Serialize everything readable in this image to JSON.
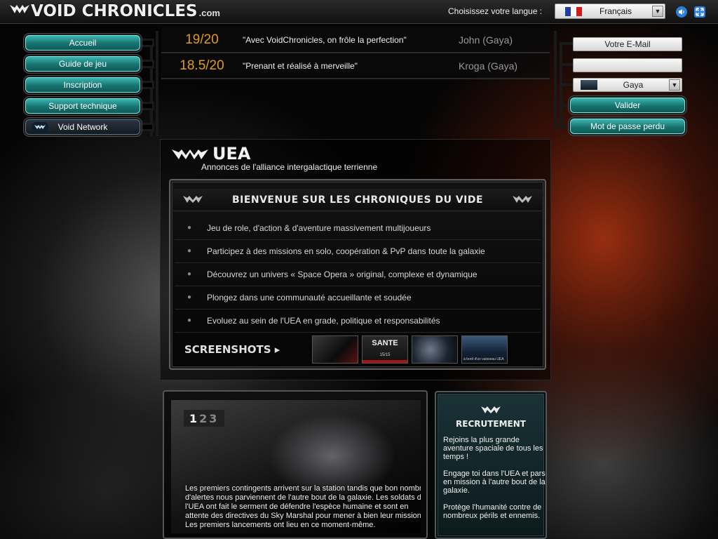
{
  "header": {
    "logo_text": "VOID CHRONICLES",
    "logo_suffix": ".com",
    "language_label": "Choisissez votre langue :",
    "language_value": "Français",
    "sound_icon": "speaker-icon",
    "fullscreen_icon": "fullscreen-icon"
  },
  "nav": {
    "items": [
      {
        "label": "Accueil"
      },
      {
        "label": "Guide de jeu"
      },
      {
        "label": "Inscription"
      },
      {
        "label": "Support technique"
      },
      {
        "label": "Void Network"
      }
    ]
  },
  "reviews": [
    {
      "score": "19/20",
      "quote": "\"Avec VoidChronicles, on frôle la perfection\"",
      "author": "John (Gaya)"
    },
    {
      "score": "18.5/20",
      "quote": "\"Prenant et réalisé à merveille\"",
      "author": "Kroga (Gaya)"
    }
  ],
  "login": {
    "email_placeholder": "Votre E-Mail",
    "password_placeholder": "",
    "server_value": "Gaya",
    "submit_label": "Valider",
    "forgot_label": "Mot de passe perdu"
  },
  "uea": {
    "title": "UEA",
    "subtitle": "Annonces de l'alliance intergalactique terrienne",
    "welcome_title": "BIENVENUE SUR LES CHRONIQUES DU VIDE",
    "features": [
      "Jeu de role, d'action & d'aventure massivement multijoueurs",
      "Participez à des missions en solo, coopération & PvP dans toute la galaxie",
      "Découvrez un univers « Space Opera » original, complexe et dynamique",
      "Plongez dans une communauté accueillante et soudée",
      "Evoluez au sein de l'UEA en grade, politique et responsabilités"
    ],
    "screenshots_label": "SCREENSHOTS ▸",
    "shot_2_title": "SANTE",
    "shot_2_sub": "15/15",
    "shot_4_caption": "à bord d'un vaisseau UEA"
  },
  "news": {
    "pages": [
      "1",
      "2",
      "3"
    ],
    "active_page": "1",
    "text": "Les premiers contingents arrivent sur la station tandis que bon nombre d'alertes nous parviennent de l'autre bout de la galaxie. Les soldats de l'UEA ont fait le serment de défendre l'espèce humaine et sont en attente des directives du Sky Marshal pour mener à bien leur mission. Les premiers lancements ont lieu en ce moment-même."
  },
  "recruit": {
    "title": "RECRUTEMENT",
    "p1": "Rejoins la plus grande aventure spaciale de tous les temps !",
    "p2": "Engage toi dans l'UEA et pars en mission à l'autre bout de la galaxie.",
    "p3": "Protège l'humanité contre de nombreux périls et ennemis."
  },
  "colors": {
    "accent_teal": "#17736f",
    "score_orange": "#e09a28"
  }
}
